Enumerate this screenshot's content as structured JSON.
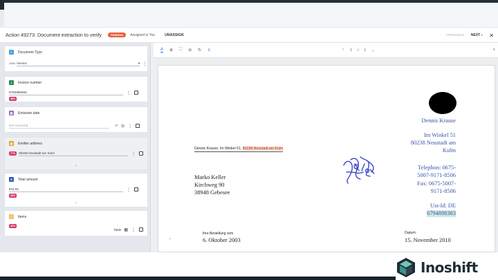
{
  "action": {
    "title": "Action 49273: Document extraction to verify",
    "status": "PENDING",
    "assigned": "Assigned to You",
    "unassign_label": "UNASSIGN"
  },
  "nav": {
    "previous": "‹ PREVIOUS",
    "next": "NEXT ›",
    "close": "✕"
  },
  "fields": [
    {
      "label": "Document Type",
      "icon_letter": "≡",
      "icon_color": "#4aa3df",
      "confidence": "100%",
      "value": "Invoice"
    },
    {
      "label": "Invoice number",
      "icon_letter": "1",
      "icon_color": "#2e8b57",
      "confidence": "48%",
      "value": "6794898383"
    },
    {
      "label": "Emission date",
      "icon_letter": "▦",
      "icon_color": "#9b6fd3",
      "confidence": "",
      "value": "Not extracted"
    },
    {
      "label": "Emitter address",
      "icon_letter": "▤",
      "icon_color": "#f0a030",
      "confidence": "77%",
      "value": "80238 Neustadt am Kulm"
    },
    {
      "label": "Total amount",
      "icon_letter": "$",
      "icon_color": "#2d5fbf",
      "confidence": "38%",
      "value": "841.91"
    },
    {
      "label": "Items",
      "icon_letter": "≡",
      "icon_color": "#f5c06a",
      "confidence": "40%",
      "value": "Table"
    }
  ],
  "viewer": {
    "page": "1",
    "page_sep": "/",
    "page_total": "1"
  },
  "document": {
    "sender_prefix": "Dennis Krause, Im Winkel 51,",
    "sender_highlight": "80238 Neustadt am Kulm",
    "recipient": [
      "Marko Keller",
      "Kirchweg 90",
      "38948 Gebesee"
    ],
    "letterhead": {
      "name": "Dennis Krause",
      "street": "Im Winkel 51",
      "city1": "80238 Neustadt am",
      "city2": "Kulm",
      "phone1": "Telephon:  0675-",
      "phone2": "5007-9171-8506",
      "fax1": "Fax:  0675-5007-",
      "fax2": "9171-8506",
      "ustid": "Ust-Id: DE",
      "ustnum": "6794898383"
    },
    "order_label": "Ihre Bestellung vom",
    "order_date": "6. Oktober 2003",
    "date_label": "Datum",
    "date_value": "15. November 2010",
    "margin_mark": "–"
  },
  "brand": {
    "name": "Inoshift"
  },
  "colors": {
    "accent_blue": "#2a63c9",
    "badge_red": "#e8603c",
    "confidence_pink": "#d93a6a",
    "letter_blue": "#3853a9"
  }
}
